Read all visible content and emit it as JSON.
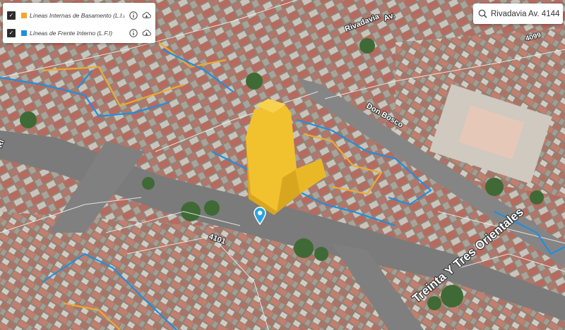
{
  "layers": {
    "items": [
      {
        "label": "Líneas Internas de Basamento (L.I.B)",
        "color": "#f0a830",
        "checked": true,
        "info_icon": "info-icon",
        "download_icon": "cloud-download-icon"
      },
      {
        "label": "Líneas de Frente Interno (L.F.I)",
        "color": "#1f8fe0",
        "checked": true,
        "info_icon": "info-icon",
        "download_icon": "cloud-download-icon"
      }
    ]
  },
  "search": {
    "value": "Rivadavia Av. 4144",
    "icon": "search-icon"
  },
  "map": {
    "street_labels": [
      {
        "text": "Treinta Y Tres Orientales"
      },
      {
        "text": "Don Bosco"
      },
      {
        "text": "4101"
      },
      {
        "text": "Rivadavia"
      },
      {
        "text": "Av."
      },
      {
        "text": "4099"
      },
      {
        "text": "Ri"
      }
    ],
    "building_color": "#f2c12e",
    "marker_color": "#2aa3e0",
    "marker_icon": "location-pin-icon"
  }
}
